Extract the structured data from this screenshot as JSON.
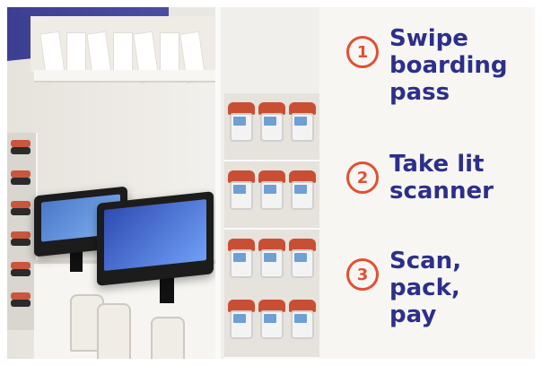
{
  "scene": {
    "colors": {
      "brand_navy": "#2d2f8a",
      "accent_red": "#e24f33",
      "panel_bg": "#f7f6f3"
    },
    "steps": [
      {
        "number": "1",
        "text": "Swipe\nboarding\npass"
      },
      {
        "number": "2",
        "text": "Take lit\nscanner"
      },
      {
        "number": "3",
        "text": "Scan,\npack,\npay"
      }
    ]
  }
}
